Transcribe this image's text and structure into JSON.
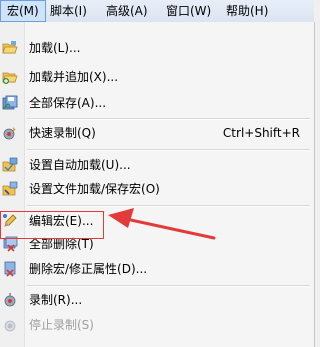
{
  "menubar": {
    "items": [
      {
        "label": "宏(M)"
      },
      {
        "label": "脚本(I)"
      },
      {
        "label": "高级(A)"
      },
      {
        "label": "窗口(W)"
      },
      {
        "label": "帮助(H)"
      }
    ]
  },
  "dropdown": {
    "items": [
      {
        "label": "加载(L)...",
        "icon": "folder-open-icon"
      },
      {
        "label": "加载并追加(X)...",
        "icon": "folder-add-icon"
      },
      {
        "label": "全部保存(A)...",
        "icon": "save-all-icon"
      },
      {
        "label": "快速录制(Q)",
        "shortcut": "Ctrl+Shift+R",
        "icon": "quick-record-icon"
      },
      {
        "label": "设置自动加载(U)...",
        "icon": "autoload-icon"
      },
      {
        "label": "设置文件加载/保存宏(O)",
        "icon": "file-macro-icon"
      },
      {
        "label": "编辑宏(E)...",
        "icon": "edit-macro-icon"
      },
      {
        "label": "全部删除(T)",
        "icon": "delete-all-icon"
      },
      {
        "label": "删除宏/修正属性(D)...",
        "icon": "delete-macro-icon"
      },
      {
        "label": "录制(R)...",
        "icon": "record-icon"
      },
      {
        "label": "停止录制(S)",
        "icon": "stop-record-icon",
        "disabled": true
      }
    ]
  },
  "colors": {
    "highlight_box": "#e33b3b",
    "arrow": "#e33b3b"
  }
}
